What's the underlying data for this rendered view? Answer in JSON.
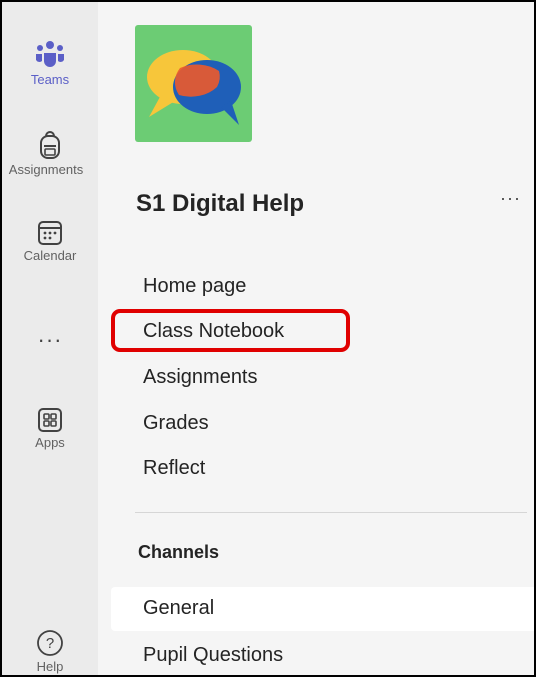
{
  "rail": {
    "items": [
      {
        "label": "Teams",
        "icon": "teams-icon",
        "active": true
      },
      {
        "label": "Assignments",
        "icon": "backpack-icon"
      },
      {
        "label": "Calendar",
        "icon": "calendar-icon"
      },
      {
        "label": "",
        "icon": "more-icon"
      },
      {
        "label": "Apps",
        "icon": "apps-icon"
      },
      {
        "label": "Help",
        "icon": "help-icon"
      }
    ],
    "more_glyph": "···"
  },
  "team": {
    "name": "S1 Digital Help",
    "more_glyph": "···",
    "avatar_icon": "speech-bubbles-icon"
  },
  "nav": {
    "items": [
      "Home page",
      "Class Notebook",
      "Assignments",
      "Grades",
      "Reflect"
    ],
    "highlighted": "Class Notebook"
  },
  "channels": {
    "title": "Channels",
    "items": [
      "General",
      "Pupil Questions"
    ],
    "selected": "General"
  },
  "colors": {
    "accent": "#5b5fc7",
    "highlight": "#e00000",
    "avatar_bg": "#6ccc74"
  }
}
